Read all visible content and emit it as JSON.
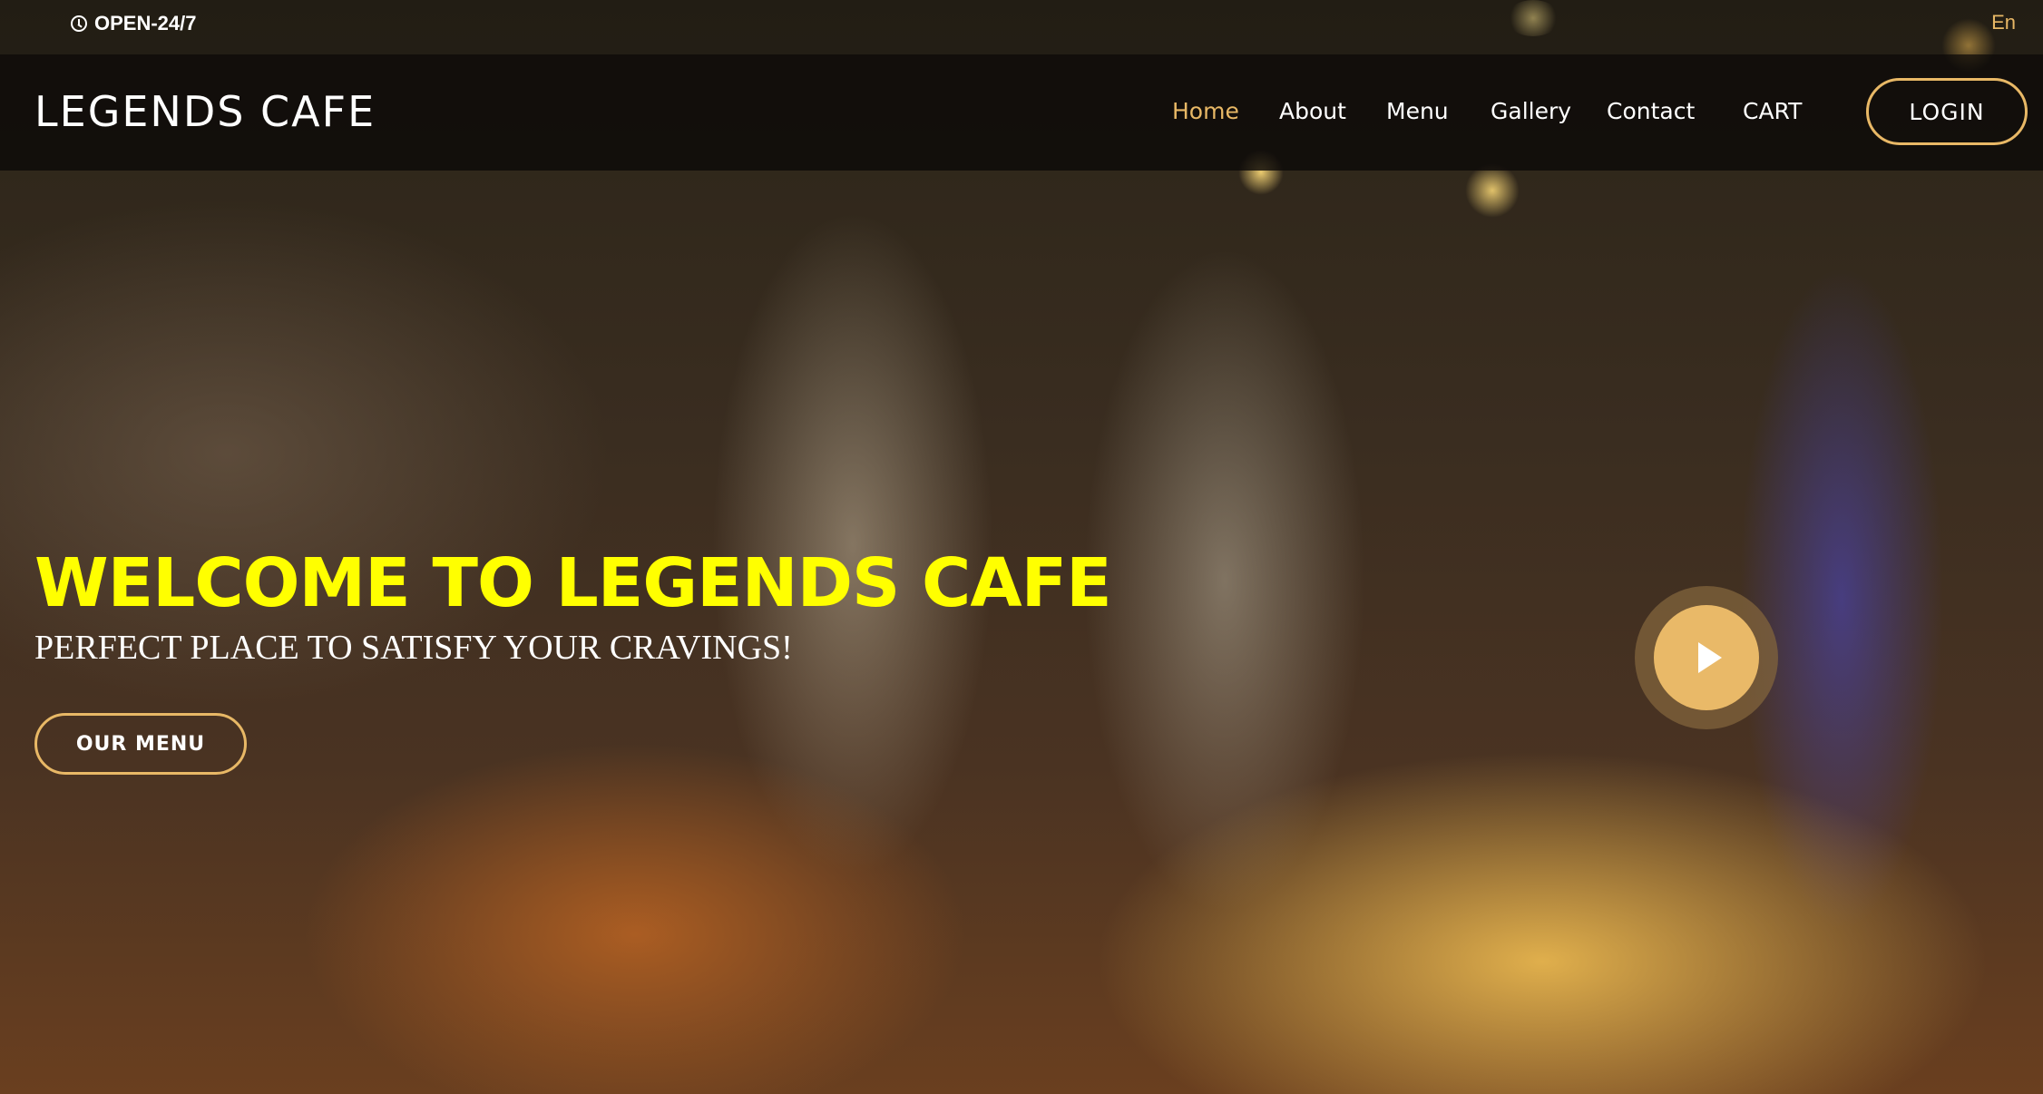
{
  "topbar": {
    "open_hours": "OPEN-24/7",
    "language": "En"
  },
  "header": {
    "brand": "LEGENDS CAFE",
    "nav": [
      {
        "label": "Home",
        "active": true
      },
      {
        "label": "About",
        "active": false
      },
      {
        "label": "Menu",
        "active": false
      },
      {
        "label": "Gallery",
        "active": false
      },
      {
        "label": "Contact",
        "active": false
      },
      {
        "label": "CART",
        "active": false
      }
    ],
    "login_label": "LOGIN"
  },
  "hero": {
    "title": "WELCOME TO LEGENDS CAFE",
    "subtitle": "PERFECT PLACE TO SATISFY YOUR CRAVINGS!",
    "menu_button": "OUR MENU",
    "play_button_icon": "play-icon"
  },
  "colors": {
    "accent": "#e8b866",
    "title": "#ffff00",
    "header_bg": "#0c0a08"
  }
}
